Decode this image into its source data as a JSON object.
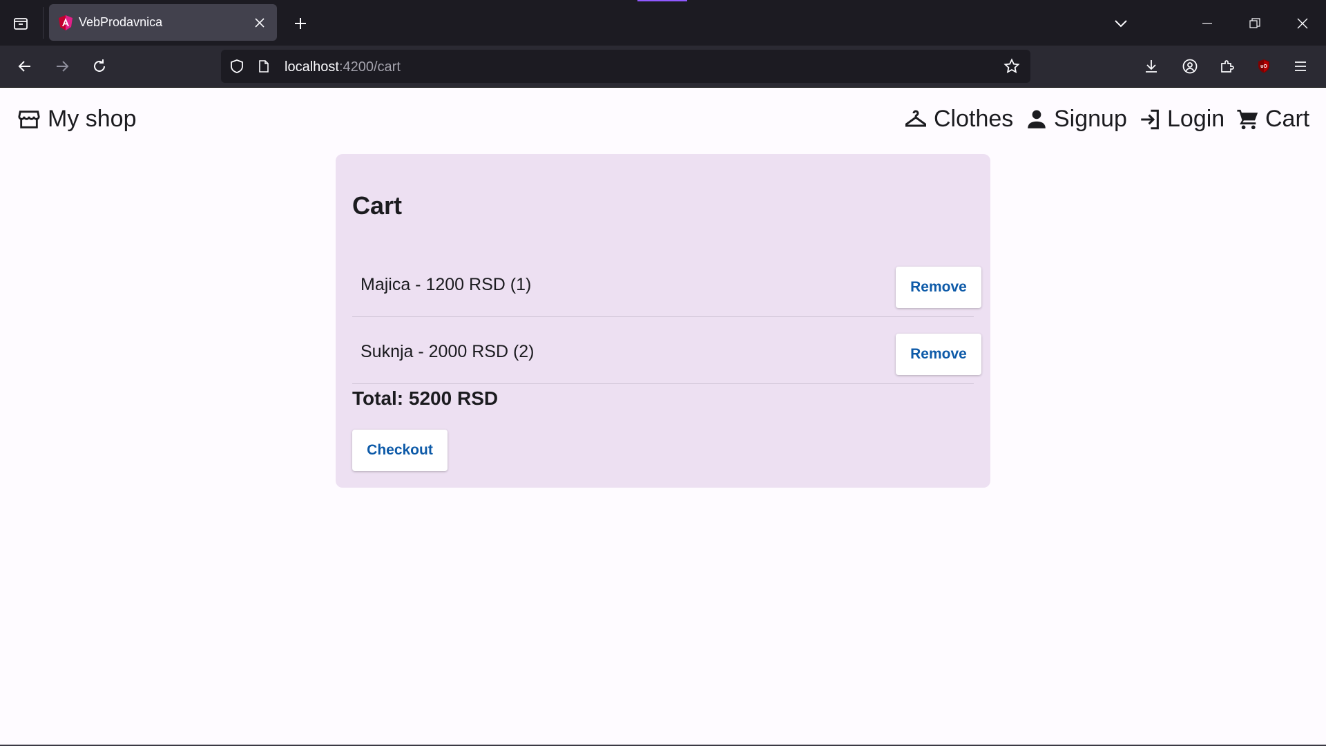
{
  "browser": {
    "tab": {
      "title": "VebProdavnica"
    },
    "url": {
      "host": "localhost",
      "rest": ":4200/cart"
    },
    "colors": {
      "tabbar": "#1c1b22",
      "navbar": "#2b2a33",
      "accent": "#9059ff"
    }
  },
  "app": {
    "brand": {
      "icon": "storefront-icon",
      "label": "My shop"
    },
    "nav": [
      {
        "icon": "hanger-icon",
        "label": "Clothes"
      },
      {
        "icon": "person-icon",
        "label": "Signup"
      },
      {
        "icon": "login-icon",
        "label": "Login"
      },
      {
        "icon": "cart-icon",
        "label": "Cart"
      }
    ],
    "cart": {
      "title": "Cart",
      "items": [
        {
          "text": "Majica - 1200 RSD (1)",
          "remove_label": "Remove"
        },
        {
          "text": "Suknja - 2000 RSD (2)",
          "remove_label": "Remove"
        }
      ],
      "total": "Total: 5200 RSD",
      "checkout_label": "Checkout"
    },
    "colors": {
      "card": "#ede0f2",
      "button_text": "#0d5aa8",
      "page": "#fefbff"
    }
  }
}
